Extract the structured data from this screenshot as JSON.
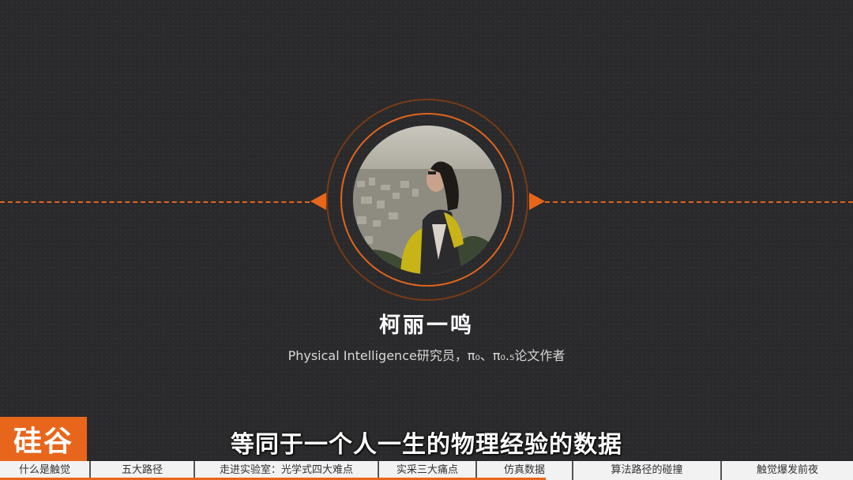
{
  "speaker": {
    "name": "柯丽一鸣",
    "title": "Physical Intelligence研究员，π₀、π₀.₅论文作者"
  },
  "subtitle": "等同于一个人一生的物理经验的数据",
  "logo": {
    "text": "硅谷",
    "icon": "brand-logo-icon"
  },
  "colors": {
    "accent": "#e8661c",
    "background": "#2a2a2c",
    "nav_bg": "#f2f2f2"
  },
  "chapters": [
    {
      "label": "什么是触觉"
    },
    {
      "label": "五大路径"
    },
    {
      "label": "走进实验室：光学式四大难点"
    },
    {
      "label": "实采三大痛点"
    },
    {
      "label": "仿真数据"
    },
    {
      "label": "算法路径的碰撞"
    },
    {
      "label": "触觉爆发前夜"
    }
  ],
  "progress": {
    "fraction": 0.64
  }
}
